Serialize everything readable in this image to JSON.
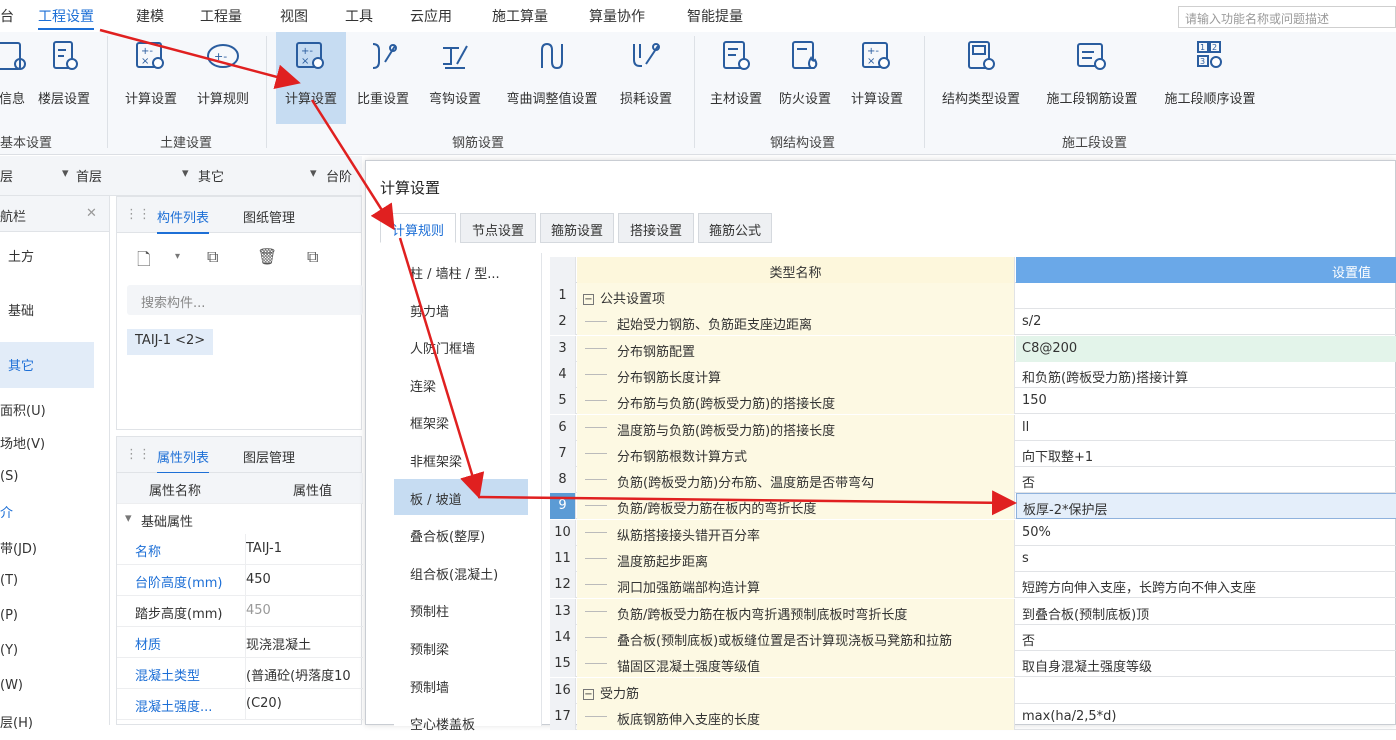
{
  "menu": {
    "items": [
      "台",
      "工程设置",
      "建模",
      "工程量",
      "视图",
      "工具",
      "云应用",
      "施工算量",
      "算量协作",
      "智能提量"
    ],
    "active": "工程设置",
    "search_placeholder": "请输入功能名称或问题描述"
  },
  "ribbon": {
    "groups": [
      {
        "label": "基本设置",
        "buttons": [
          "信息",
          "楼层设置"
        ]
      },
      {
        "label": "土建设置",
        "buttons": [
          "计算设置",
          "计算规则"
        ]
      },
      {
        "label": "钢筋设置",
        "buttons": [
          "计算设置",
          "比重设置",
          "弯钩设置",
          "弯曲调整值设置",
          "损耗设置"
        ]
      },
      {
        "label": "钢结构设置",
        "buttons": [
          "主材设置",
          "防火设置",
          "计算设置"
        ]
      },
      {
        "label": "施工段设置",
        "buttons": [
          "结构类型设置",
          "施工段钢筋设置",
          "施工段顺序设置"
        ]
      }
    ]
  },
  "floorbar": {
    "a": "层",
    "b": "首层",
    "c": "其它",
    "d": "台阶"
  },
  "nav": {
    "title": "航栏",
    "items": [
      "土方",
      "基础",
      "其它"
    ],
    "selected": "其它",
    "texts": [
      "面积(U)",
      "场地(V)",
      "(S)",
      "介",
      "带(JD)",
      "(T)",
      "(P)",
      "(Y)",
      "(W)",
      "层(H)"
    ]
  },
  "component_panel": {
    "tabs": [
      "构件列表",
      "图纸管理"
    ],
    "search_placeholder": "搜索构件...",
    "item": "TAIJ-1 <2>"
  },
  "property_panel": {
    "tabs": [
      "属性列表",
      "图层管理"
    ],
    "col_name": "属性名称",
    "col_value": "属性值",
    "group": "基础属性",
    "rows": [
      {
        "k": "名称",
        "v": "TAIJ-1",
        "blue": true
      },
      {
        "k": "台阶高度(mm)",
        "v": "450",
        "blue": true
      },
      {
        "k": "踏步高度(mm)",
        "v": "450",
        "blue": false
      },
      {
        "k": "材质",
        "v": "现浇混凝土",
        "blue": true
      },
      {
        "k": "混凝土类型",
        "v": "(普通砼(坍落度10",
        "blue": true
      },
      {
        "k": "混凝土强度...",
        "v": "(C20)",
        "blue": true
      }
    ]
  },
  "dialog": {
    "title": "计算设置",
    "tabs": [
      "计算规则",
      "节点设置",
      "箍筋设置",
      "搭接设置",
      "箍筋公式"
    ],
    "active_tab": "计算规则",
    "left_items": [
      "柱 / 墙柱 / 型...",
      "剪力墙",
      "人防门框墙",
      "连梁",
      "框架梁",
      "非框架梁",
      "板 / 坡道",
      "叠合板(整厚)",
      "组合板(混凝土)",
      "预制柱",
      "预制梁",
      "预制墙",
      "空心楼盖板"
    ],
    "left_selected": "板 / 坡道",
    "grid_header": {
      "type": "类型名称",
      "value": "设置值"
    },
    "rows": [
      {
        "n": "1",
        "t": "公共设置项",
        "v": "",
        "group": true
      },
      {
        "n": "2",
        "t": "起始受力钢筋、负筋距支座边距离",
        "v": "s/2"
      },
      {
        "n": "3",
        "t": "分布钢筋配置",
        "v": "C8@200",
        "hl": "green"
      },
      {
        "n": "4",
        "t": "分布钢筋长度计算",
        "v": "和负筋(跨板受力筋)搭接计算"
      },
      {
        "n": "5",
        "t": "分布筋与负筋(跨板受力筋)的搭接长度",
        "v": "150"
      },
      {
        "n": "6",
        "t": "温度筋与负筋(跨板受力筋)的搭接长度",
        "v": "ll"
      },
      {
        "n": "7",
        "t": "分布钢筋根数计算方式",
        "v": "向下取整+1"
      },
      {
        "n": "8",
        "t": "负筋(跨板受力筋)分布筋、温度筋是否带弯勾",
        "v": "否"
      },
      {
        "n": "9",
        "t": "负筋/跨板受力筋在板内的弯折长度",
        "v": "板厚-2*保护层",
        "sel": true
      },
      {
        "n": "10",
        "t": "纵筋搭接接头错开百分率",
        "v": "50%"
      },
      {
        "n": "11",
        "t": "温度筋起步距离",
        "v": "s"
      },
      {
        "n": "12",
        "t": "洞口加强筋端部构造计算",
        "v": "短跨方向伸入支座，长跨方向不伸入支座"
      },
      {
        "n": "13",
        "t": "负筋/跨板受力筋在板内弯折遇预制底板时弯折长度",
        "v": "到叠合板(预制底板)顶"
      },
      {
        "n": "14",
        "t": "叠合板(预制底板)或板缝位置是否计算现浇板马凳筋和拉筋",
        "v": "否"
      },
      {
        "n": "15",
        "t": "锚固区混凝土强度等级值",
        "v": "取自身混凝土强度等级"
      },
      {
        "n": "16",
        "t": "受力筋",
        "v": "",
        "group": true
      },
      {
        "n": "17",
        "t": "板底钢筋伸入支座的长度",
        "v": "max(ha/2,5*d)"
      }
    ]
  },
  "colors": {
    "accent": "#1d6fd6",
    "arrow": "#e02020",
    "selected_bg": "#c6dcf2",
    "header_blue": "#6aa8e8"
  }
}
